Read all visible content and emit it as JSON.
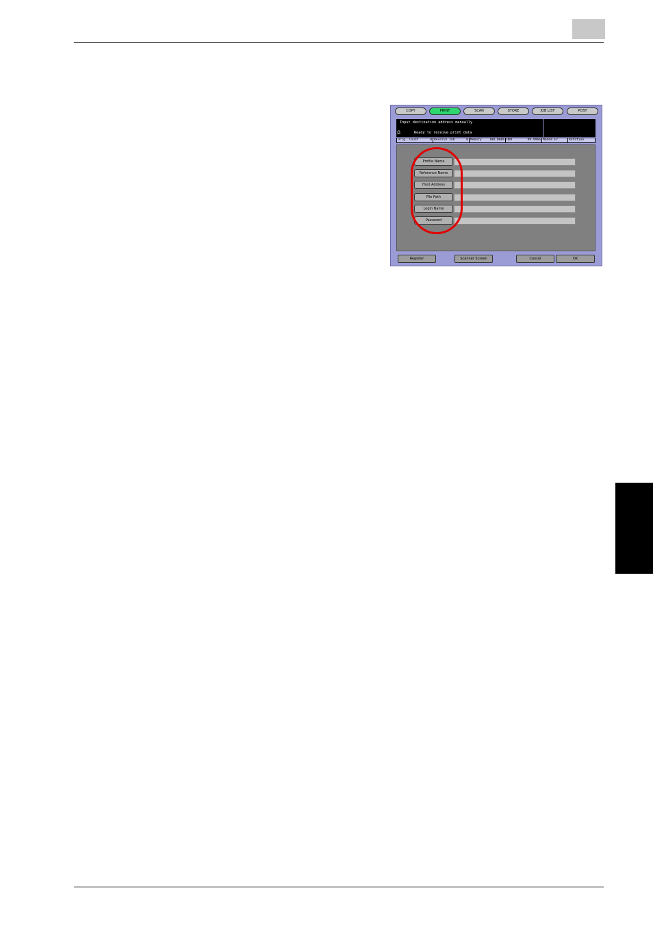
{
  "screen": {
    "mode_tabs": [
      {
        "label": "COPY",
        "active": false
      },
      {
        "label": "PRINT",
        "active": true
      },
      {
        "label": "SCAN",
        "active": false
      },
      {
        "label": "STORE",
        "active": false
      },
      {
        "label": "JOB LIST",
        "active": false
      },
      {
        "label": "POST",
        "active": false
      }
    ],
    "message_title": "Input destination address manually",
    "message_status": "Ready to receive print data",
    "status_bar": {
      "orig_count": "Orig. Count",
      "orig_count_value": "0",
      "reserve_job": "Reserve Job",
      "reserve_job_value": "0",
      "memory": "Memory",
      "memory_value": "100.000%",
      "hdd": "HDD",
      "hdd_value": "99.996%",
      "modem": "Modem Er.",
      "rotation": "Rotation"
    },
    "fields": [
      {
        "label": "Profile Name"
      },
      {
        "label": "Reference Name"
      },
      {
        "label": "Host Address"
      },
      {
        "label": "File Path"
      },
      {
        "label": "Login Name"
      },
      {
        "label": "Password"
      }
    ],
    "buttons": {
      "register": "Register",
      "scanner_screen": "Scanner Screen",
      "cancel": "Cancel",
      "ok": "OK"
    },
    "colors": {
      "panel_frame": "#9b9bd6",
      "active_tab": "#2fd670",
      "highlight": "#e00000"
    }
  }
}
